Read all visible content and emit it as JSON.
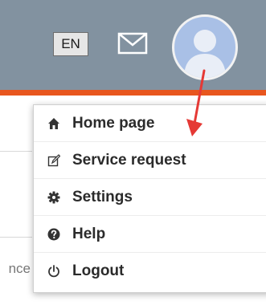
{
  "header": {
    "language": "EN",
    "mail_icon": "envelope-icon",
    "avatar_icon": "user-avatar-icon",
    "bar_color": "#8292a0",
    "accent_color": "#e8561e"
  },
  "page": {
    "fragment_text": "nce"
  },
  "user_menu": {
    "items": [
      {
        "label": "Home page",
        "icon": "home-icon"
      },
      {
        "label": "Service request",
        "icon": "edit-icon"
      },
      {
        "label": "Settings",
        "icon": "gear-icon"
      },
      {
        "label": "Help",
        "icon": "help-icon"
      },
      {
        "label": "Logout",
        "icon": "power-icon"
      }
    ]
  },
  "annotation": {
    "arrow_color": "#e53935"
  }
}
